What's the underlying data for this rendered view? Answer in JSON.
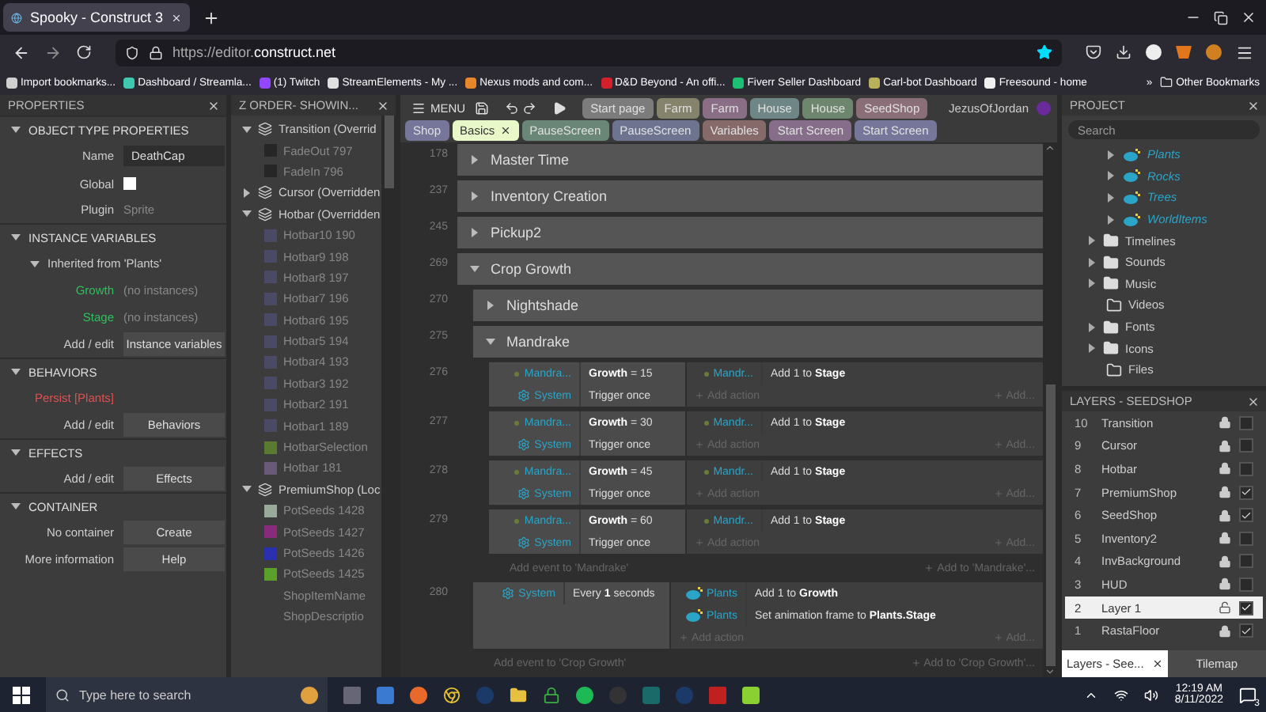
{
  "browser": {
    "tab_title": "Spooky - Construct 3",
    "url": "https://editor.**construct.net**",
    "bookmarks": [
      {
        "label": "Import bookmarks...",
        "color": "#d0d0d0"
      },
      {
        "label": "Dashboard / Streamla...",
        "color": "#3ec9b0"
      },
      {
        "label": "(1) Twitch",
        "color": "#9146ff"
      },
      {
        "label": "StreamElements - My ...",
        "color": "#e0e0e0"
      },
      {
        "label": "Nexus mods and com...",
        "color": "#e8862a"
      },
      {
        "label": "D&D Beyond - An offi...",
        "color": "#d4202a"
      },
      {
        "label": "Fiverr Seller Dashboard",
        "color": "#1dbf73"
      },
      {
        "label": "Carl-bot Dashboard",
        "color": "#b8b05a"
      },
      {
        "label": "Freesound - home",
        "color": "#f0f0f0"
      }
    ],
    "more": "»",
    "other_bookmarks": "Other Bookmarks"
  },
  "properties": {
    "title": "PROPERTIES",
    "sections": [
      {
        "title": "OBJECT TYPE PROPERTIES",
        "expanded": true,
        "rows": [
          {
            "kind": "input",
            "label": "Name",
            "value": "DeathCap"
          },
          {
            "kind": "checkbox",
            "label": "Global",
            "checked": false
          },
          {
            "kind": "text",
            "label": "Plugin",
            "value": "Sprite"
          }
        ]
      },
      {
        "title": "INSTANCE VARIABLES",
        "expanded": true,
        "rows": [
          {
            "kind": "subheader",
            "label": "Inherited from 'Plants'",
            "expanded": true
          },
          {
            "kind": "variable",
            "label": "Growth",
            "value": "(no instances)"
          },
          {
            "kind": "variable",
            "label": "Stage",
            "value": "(no instances)"
          },
          {
            "kind": "button",
            "label": "Add / edit",
            "value": "Instance variables"
          }
        ]
      },
      {
        "title": "BEHAVIORS",
        "expanded": true,
        "rows": [
          {
            "kind": "behavior",
            "label": "Persist [Plants]"
          },
          {
            "kind": "button",
            "label": "Add / edit",
            "value": "Behaviors"
          }
        ]
      },
      {
        "title": "EFFECTS",
        "expanded": true,
        "rows": [
          {
            "kind": "button",
            "label": "Add / edit",
            "value": "Effects"
          }
        ]
      },
      {
        "title": "CONTAINER",
        "expanded": true,
        "rows": [
          {
            "kind": "button",
            "label": "No container",
            "value": "Create"
          },
          {
            "kind": "button",
            "label": "More information",
            "value": "Help"
          }
        ]
      }
    ]
  },
  "z_order": {
    "title": "Z ORDER- SHOWIN...",
    "layers": [
      {
        "name": "Transition (Overrid",
        "expanded": true,
        "children": [
          {
            "name": "FadeOut 797",
            "color": "#262626"
          },
          {
            "name": "FadeIn 796",
            "color": "#262626"
          }
        ]
      },
      {
        "name": "Cursor (Overridden",
        "expanded": false
      },
      {
        "name": "Hotbar (Overridden",
        "expanded": true,
        "children": [
          {
            "name": "Hotbar10 190",
            "color": "#4a4a66"
          },
          {
            "name": "Hotbar9 198",
            "color": "#4a4a66"
          },
          {
            "name": "Hotbar8 197",
            "color": "#4a4a66"
          },
          {
            "name": "Hotbar7 196",
            "color": "#4a4a66"
          },
          {
            "name": "Hotbar6 195",
            "color": "#4a4a66"
          },
          {
            "name": "Hotbar5 194",
            "color": "#4a4a66"
          },
          {
            "name": "Hotbar4 193",
            "color": "#4a4a66"
          },
          {
            "name": "Hotbar3 192",
            "color": "#4a4a66"
          },
          {
            "name": "Hotbar2 191",
            "color": "#4a4a66"
          },
          {
            "name": "Hotbar1 189",
            "color": "#4a4a66"
          },
          {
            "name": "HotbarSelection",
            "color": "#5a7a30"
          },
          {
            "name": "Hotbar 181",
            "color": "#6a5a7a"
          }
        ]
      },
      {
        "name": "PremiumShop (Loc",
        "expanded": true,
        "children": [
          {
            "name": "PotSeeds 1428",
            "color": "#9aaa9a"
          },
          {
            "name": "PotSeeds 1427",
            "color": "#8a2a7a"
          },
          {
            "name": "PotSeeds 1426",
            "color": "#2a30b0"
          },
          {
            "name": "PotSeeds 1425",
            "color": "#5aa02a"
          },
          {
            "name": "ShopItemName"
          },
          {
            "name": "ShopDescriptio"
          }
        ]
      }
    ]
  },
  "event_sheet": {
    "menu": "MENU",
    "user": "JezusOfJordan",
    "tabs": [
      [
        {
          "label": "Start page",
          "color": "#7c7c7c",
          "selected": false
        },
        {
          "label": "Farm",
          "color": "#85836c",
          "selected": false
        },
        {
          "label": "Farm",
          "color": "#8a6e86",
          "selected": false
        },
        {
          "label": "House",
          "color": "#6e8686",
          "selected": false
        },
        {
          "label": "House",
          "color": "#6e866e",
          "selected": false
        },
        {
          "label": "SeedShop",
          "color": "#8a6e78",
          "selected": false
        }
      ],
      [
        {
          "label": "Shop",
          "color": "#75769a",
          "selected": false
        },
        {
          "label": "Basics",
          "color": "#e8f8c8",
          "selected": true
        },
        {
          "label": "PauseScreen",
          "color": "#6a8676",
          "selected": false
        },
        {
          "label": "PauseScreen",
          "color": "#6e7490",
          "selected": false
        },
        {
          "label": "Variables",
          "color": "#866a6a",
          "selected": false
        },
        {
          "label": "Start Screen",
          "color": "#866e8a",
          "selected": false
        },
        {
          "label": "Start Screen",
          "color": "#76769a",
          "selected": false
        }
      ]
    ],
    "events": [
      {
        "kind": "group",
        "line": "178",
        "title": "Master Time",
        "expanded": false
      },
      {
        "kind": "group",
        "line": "237",
        "title": "Inventory Creation",
        "expanded": false
      },
      {
        "kind": "group",
        "line": "245",
        "title": "Pickup2",
        "expanded": false
      },
      {
        "kind": "group",
        "line": "269",
        "title": "Crop Growth",
        "expanded": true,
        "add_event": "Add event to 'Crop Growth'",
        "add_to": "Add to 'Crop Growth'...",
        "children": [
          {
            "kind": "group",
            "line": "270",
            "title": "Nightshade",
            "expanded": false
          },
          {
            "kind": "group",
            "line": "275",
            "title": "Mandrake",
            "expanded": true,
            "add_event": "Add event to 'Mandrake'",
            "add_to": "Add to 'Mandrake'...",
            "children": [
              {
                "kind": "event",
                "line": "276",
                "conditions": [
                  {
                    "kind": "instance",
                    "object": "Mandra...",
                    "text": "**Growth** = 15"
                  },
                  {
                    "kind": "system",
                    "object": "System",
                    "text": "Trigger once"
                  }
                ],
                "actions": [
                  {
                    "kind": "instance",
                    "object": "Mandr...",
                    "text": "Add 1 to **Stage**"
                  }
                ],
                "add_action": "Add action",
                "add_more": "Add..."
              },
              {
                "kind": "event",
                "line": "277",
                "conditions": [
                  {
                    "kind": "instance",
                    "object": "Mandra...",
                    "text": "**Growth** = 30"
                  },
                  {
                    "kind": "system",
                    "object": "System",
                    "text": "Trigger once"
                  }
                ],
                "actions": [
                  {
                    "kind": "instance",
                    "object": "Mandr...",
                    "text": "Add 1 to **Stage**"
                  }
                ],
                "add_action": "Add action",
                "add_more": "Add..."
              },
              {
                "kind": "event",
                "line": "278",
                "conditions": [
                  {
                    "kind": "instance",
                    "object": "Mandra...",
                    "text": "**Growth** = 45"
                  },
                  {
                    "kind": "system",
                    "object": "System",
                    "text": "Trigger once"
                  }
                ],
                "actions": [
                  {
                    "kind": "instance",
                    "object": "Mandr...",
                    "text": "Add 1 to **Stage**"
                  }
                ],
                "add_action": "Add action",
                "add_more": "Add..."
              },
              {
                "kind": "event",
                "line": "279",
                "conditions": [
                  {
                    "kind": "instance",
                    "object": "Mandra...",
                    "text": "**Growth** = 60"
                  },
                  {
                    "kind": "system",
                    "object": "System",
                    "text": "Trigger once"
                  }
                ],
                "actions": [
                  {
                    "kind": "instance",
                    "object": "Mandr...",
                    "text": "Add 1 to **Stage**"
                  }
                ],
                "add_action": "Add action",
                "add_more": "Add..."
              }
            ]
          },
          {
            "kind": "event",
            "line": "280",
            "conditions": [
              {
                "kind": "system",
                "object": "System",
                "text": "Every **1** seconds"
              }
            ],
            "actions": [
              {
                "kind": "family",
                "object": "Plants",
                "text": "Add 1 to **Growth**"
              },
              {
                "kind": "family",
                "object": "Plants",
                "text": "Set animation frame to **Plants.Stage**"
              }
            ],
            "add_action": "Add action",
            "add_more": "Add..."
          }
        ]
      }
    ]
  },
  "project": {
    "title": "PROJECT",
    "search_placeholder": "Search",
    "items": [
      {
        "kind": "family",
        "name": "Plants"
      },
      {
        "kind": "family",
        "name": "Rocks"
      },
      {
        "kind": "family",
        "name": "Trees"
      },
      {
        "kind": "family",
        "name": "WorldItems"
      },
      {
        "kind": "folder",
        "name": "Timelines"
      },
      {
        "kind": "folder",
        "name": "Sounds"
      },
      {
        "kind": "folder",
        "name": "Music"
      },
      {
        "kind": "empty-folder",
        "name": "Videos"
      },
      {
        "kind": "folder",
        "name": "Fonts"
      },
      {
        "kind": "folder",
        "name": "Icons"
      },
      {
        "kind": "empty-folder",
        "name": "Files"
      }
    ]
  },
  "layers": {
    "title": "LAYERS - SEEDSHOP",
    "rows": [
      {
        "number": "10",
        "name": "Transition",
        "locked": true,
        "visible": false,
        "selected": false
      },
      {
        "number": "9",
        "name": "Cursor",
        "locked": true,
        "visible": false,
        "selected": false
      },
      {
        "number": "8",
        "name": "Hotbar",
        "locked": true,
        "visible": false,
        "selected": false
      },
      {
        "number": "7",
        "name": "PremiumShop",
        "locked": true,
        "visible": true,
        "selected": false
      },
      {
        "number": "6",
        "name": "SeedShop",
        "locked": true,
        "visible": true,
        "selected": false
      },
      {
        "number": "5",
        "name": "Inventory2",
        "locked": true,
        "visible": false,
        "selected": false
      },
      {
        "number": "4",
        "name": "InvBackground",
        "locked": true,
        "visible": false,
        "selected": false
      },
      {
        "number": "3",
        "name": "HUD",
        "locked": true,
        "visible": false,
        "selected": false
      },
      {
        "number": "2",
        "name": "Layer 1",
        "locked": false,
        "visible": true,
        "selected": true
      },
      {
        "number": "1",
        "name": "RastaFloor",
        "locked": true,
        "visible": true,
        "selected": false
      }
    ]
  },
  "bottom_tabs": [
    {
      "label": "Layers - See...",
      "selected": true
    },
    {
      "label": "Tilemap",
      "selected": false
    }
  ],
  "taskbar": {
    "search_placeholder": "Type here to search",
    "time": "12:19 AM",
    "date": "8/11/2022",
    "notifications": "3"
  }
}
